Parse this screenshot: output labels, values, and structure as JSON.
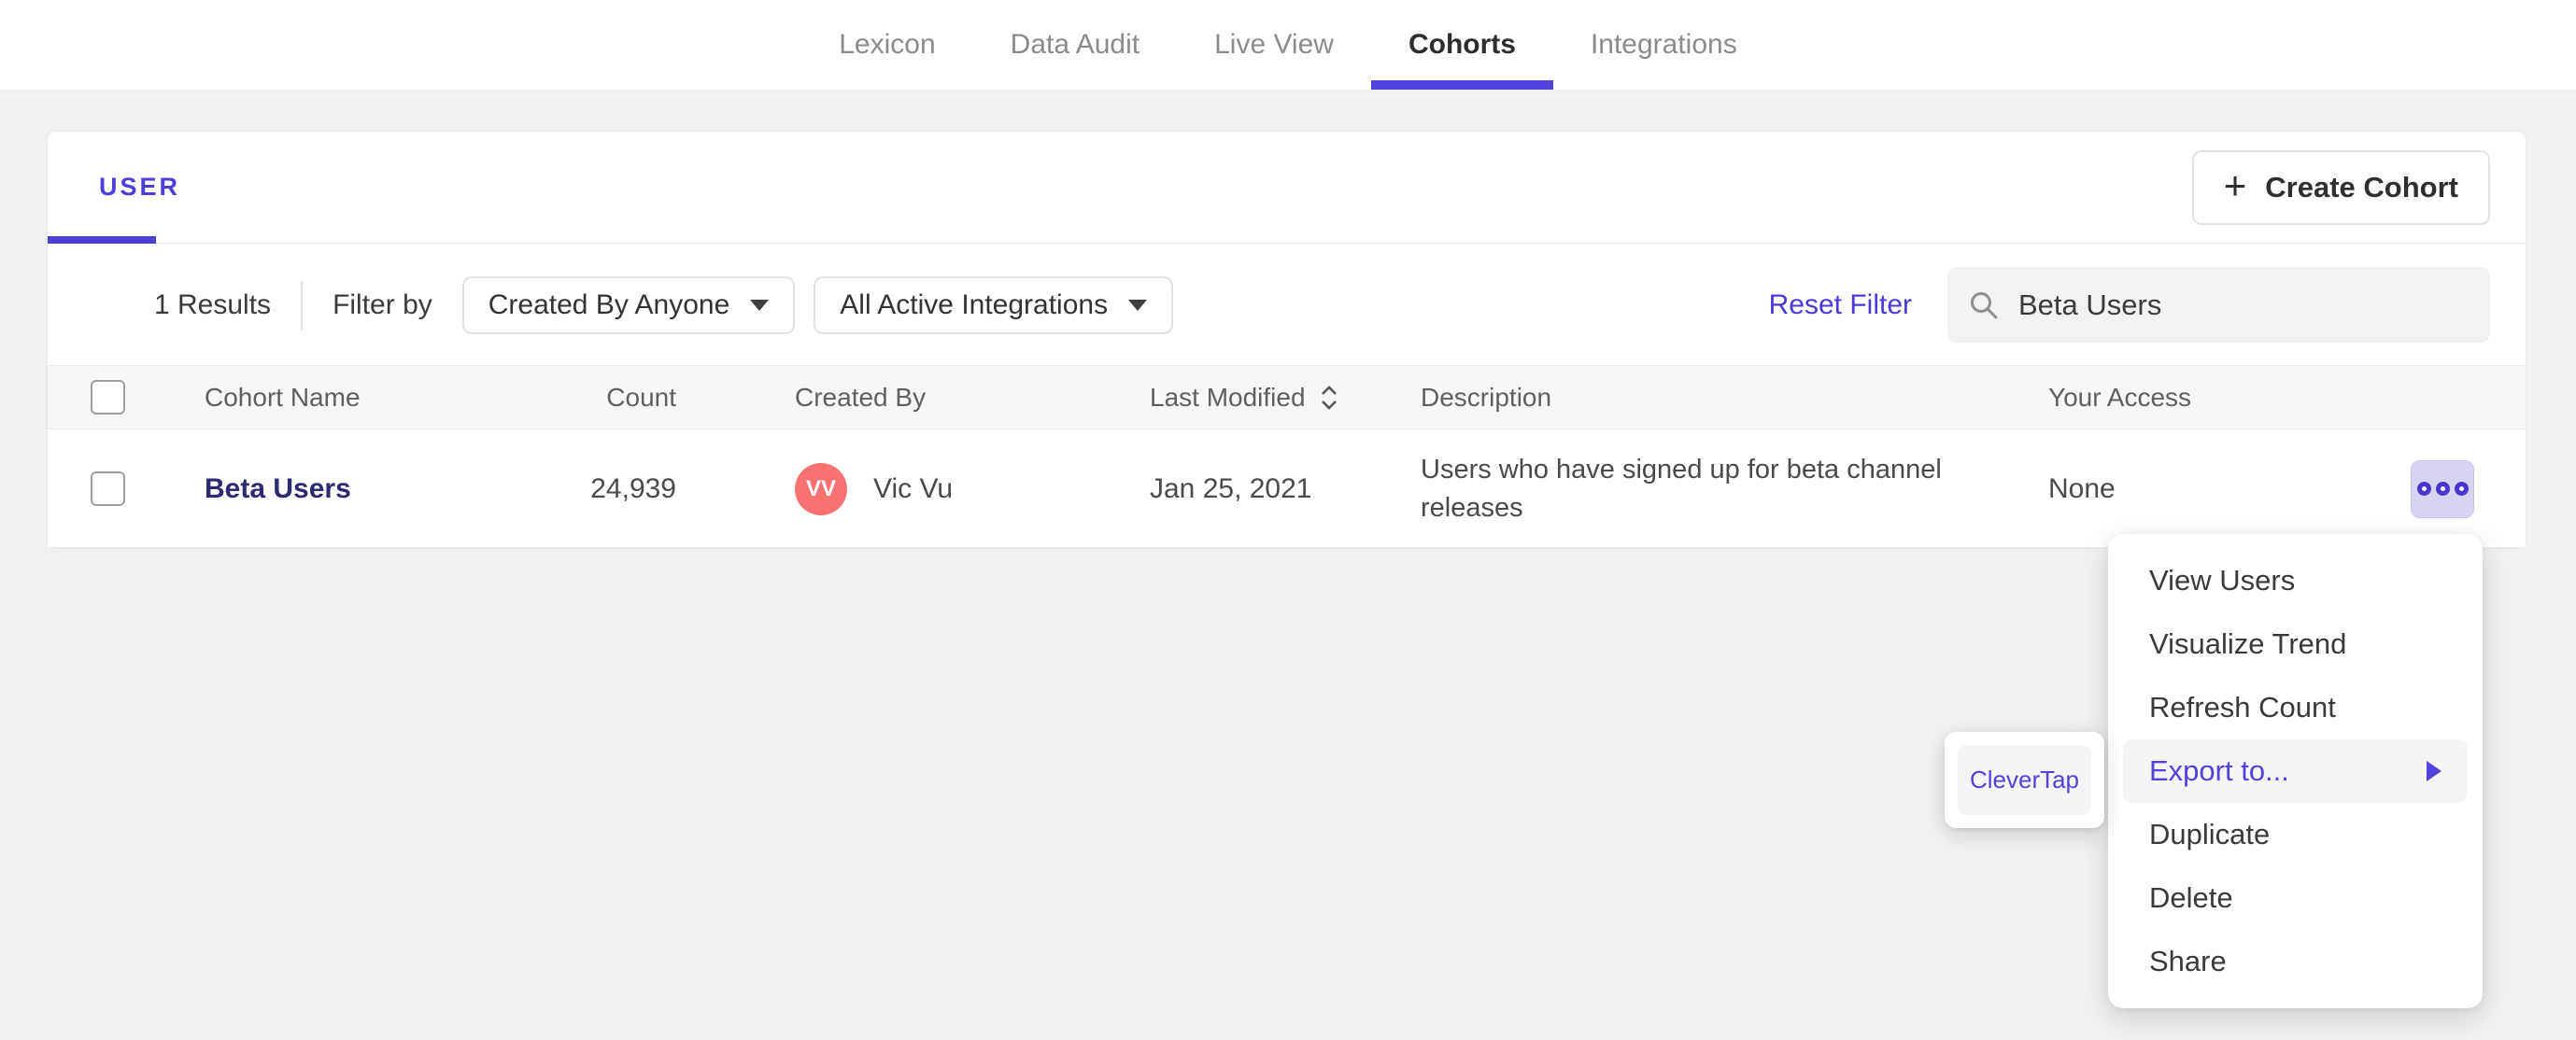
{
  "nav": {
    "tabs": [
      {
        "label": "Lexicon",
        "active": false
      },
      {
        "label": "Data Audit",
        "active": false
      },
      {
        "label": "Live View",
        "active": false
      },
      {
        "label": "Cohorts",
        "active": true
      },
      {
        "label": "Integrations",
        "active": false
      }
    ]
  },
  "cohorts_panel": {
    "tab_label": "USER",
    "create_button_label": "Create Cohort",
    "create_button_icon": "+",
    "filter_bar": {
      "results_count": "1 Results",
      "filter_by_label": "Filter by",
      "dropdowns": [
        {
          "label": "Created By Anyone"
        },
        {
          "label": "All Active Integrations"
        }
      ],
      "reset_filter_label": "Reset Filter",
      "search": {
        "value": "Beta Users",
        "placeholder": ""
      }
    },
    "table": {
      "columns": [
        "Cohort Name",
        "Count",
        "Created By",
        "Last Modified",
        "Description",
        "Your Access"
      ],
      "rows": [
        {
          "name": "Beta Users",
          "count": "24,939",
          "created_by_initials": "VV",
          "created_by_name": "Vic Vu",
          "last_modified": "Jan 25, 2021",
          "description": "Users who have signed up for beta channel releases",
          "your_access": "None"
        }
      ]
    }
  },
  "context_menu": {
    "items": [
      "View Users",
      "Visualize Trend",
      "Refresh Count",
      "Export to...",
      "Duplicate",
      "Delete",
      "Share"
    ],
    "highlighted_item": "Export to...",
    "submenu": {
      "items": [
        "CleverTap"
      ]
    }
  },
  "icons": {
    "search": "magnifier-icon",
    "sort": "sort-updown-icon",
    "dropdown_caret": "caret-down-icon",
    "more": "three-dots-icon",
    "submenu_arrow": "arrow-right-icon",
    "plus": "plus-icon"
  },
  "colors": {
    "accent_purple": "#4c3ed6",
    "link_indigo": "#2e2a72",
    "avatar_coral": "#f87272",
    "more_button_bg": "#d7d4f3",
    "highlight_row_bg": "#f5f5f6",
    "page_bg": "#f1f1f2"
  }
}
